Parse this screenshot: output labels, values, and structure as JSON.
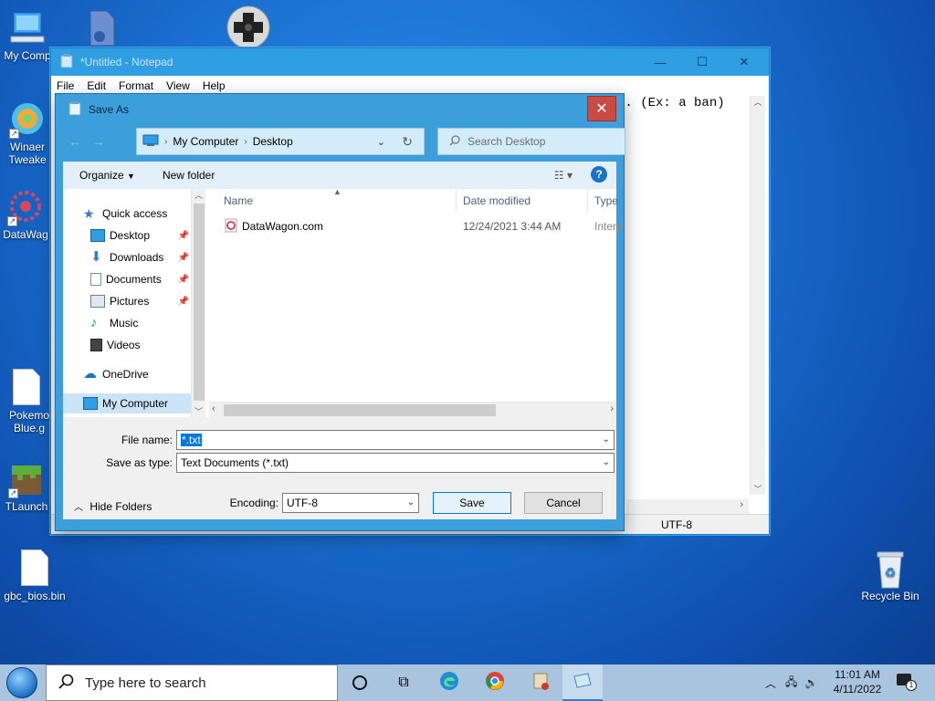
{
  "desktop": {
    "icons": [
      {
        "label": "My Comp",
        "icon": "computer-icon"
      },
      {
        "label": "",
        "icon": "gear-document-icon"
      },
      {
        "label": "",
        "icon": "gamepad-icon"
      },
      {
        "label": "Winaer Tweake",
        "icon": "winaero-tweaker-icon"
      },
      {
        "label": "DataWag",
        "icon": "datawagon-icon"
      },
      {
        "label": "Pokemo Blue.g",
        "icon": "file-icon"
      },
      {
        "label": "TLaunch",
        "icon": "minecraft-icon"
      },
      {
        "label": "gbc_bios.bin",
        "icon": "file-icon"
      },
      {
        "label": "Recycle Bin",
        "icon": "recycle-bin-icon"
      }
    ]
  },
  "notepad": {
    "title": "*Untitled - Notepad",
    "menu": [
      "File",
      "Edit",
      "Format",
      "View",
      "Help"
    ],
    "visible_text": "n. (Ex: a ban)",
    "status_encoding": "UTF-8",
    "status_partial": ")"
  },
  "dialog": {
    "title": "Save As",
    "address": {
      "root": "My Computer",
      "current": "Desktop"
    },
    "search_placeholder": "Search Desktop",
    "toolbar": {
      "organize": "Organize",
      "new_folder": "New folder"
    },
    "tree": [
      {
        "label": "Quick access",
        "icon": "star-icon",
        "pinned": false
      },
      {
        "label": "Desktop",
        "icon": "desktop-folder-icon",
        "pinned": true
      },
      {
        "label": "Downloads",
        "icon": "download-icon",
        "pinned": true
      },
      {
        "label": "Documents",
        "icon": "documents-icon",
        "pinned": true
      },
      {
        "label": "Pictures",
        "icon": "pictures-icon",
        "pinned": true
      },
      {
        "label": "Music",
        "icon": "music-icon",
        "pinned": false
      },
      {
        "label": "Videos",
        "icon": "videos-icon",
        "pinned": false
      },
      {
        "label": "OneDrive",
        "icon": "cloud-icon",
        "pinned": false
      },
      {
        "label": "My Computer",
        "icon": "computer-icon",
        "pinned": false
      }
    ],
    "columns": [
      "Name",
      "Date modified",
      "Type"
    ],
    "files": [
      {
        "name": "DataWagon.com",
        "date": "12/24/2021 3:44 AM",
        "type": "Intern"
      }
    ],
    "file_name_label": "File name:",
    "file_name_value": "*.txt",
    "save_type_label": "Save as type:",
    "save_type_value": "Text Documents (*.txt)",
    "hide_folders": "Hide Folders",
    "encoding_label": "Encoding:",
    "encoding_value": "UTF-8",
    "save_button": "Save",
    "cancel_button": "Cancel"
  },
  "taskbar": {
    "search_placeholder": "Type here to search",
    "time": "11:01 AM",
    "date": "4/11/2022",
    "notification_count": "1"
  },
  "colors": {
    "accent": "#0078d7",
    "dialog_frame": "#3c9fdc",
    "close_red": "#c94b44"
  }
}
